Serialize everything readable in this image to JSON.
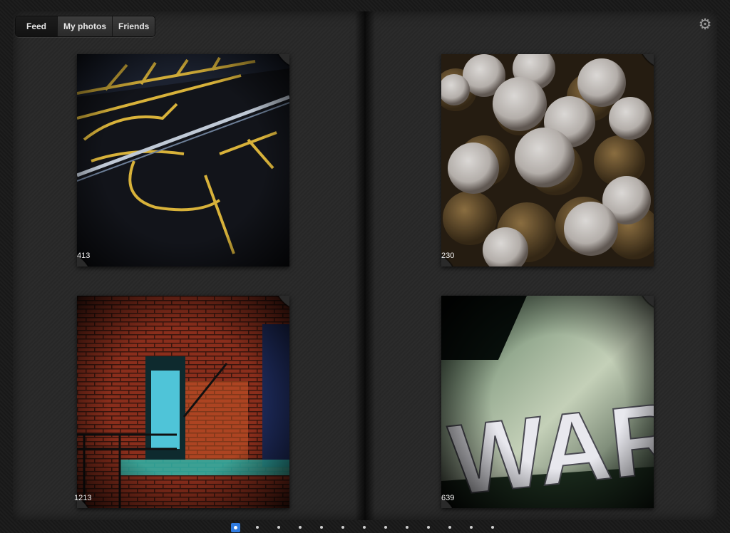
{
  "tabs": [
    {
      "label": "Feed"
    },
    {
      "label": "My photos"
    },
    {
      "label": "Friends"
    }
  ],
  "settings_icon": "gear-icon",
  "photos": [
    {
      "subject": "parking-lot-accessible-sign",
      "likes": "413"
    },
    {
      "subject": "powdered-sugar-cookies",
      "likes": "230"
    },
    {
      "subject": "brick-building-fire-escape",
      "likes": "1213"
    },
    {
      "subject": "war-sign-letters",
      "likes": "639"
    }
  ],
  "pagination": {
    "current_page": 1,
    "total_pages": 13
  },
  "colors": {
    "accent": "#2f7be0",
    "page": "#2a2a2a"
  }
}
